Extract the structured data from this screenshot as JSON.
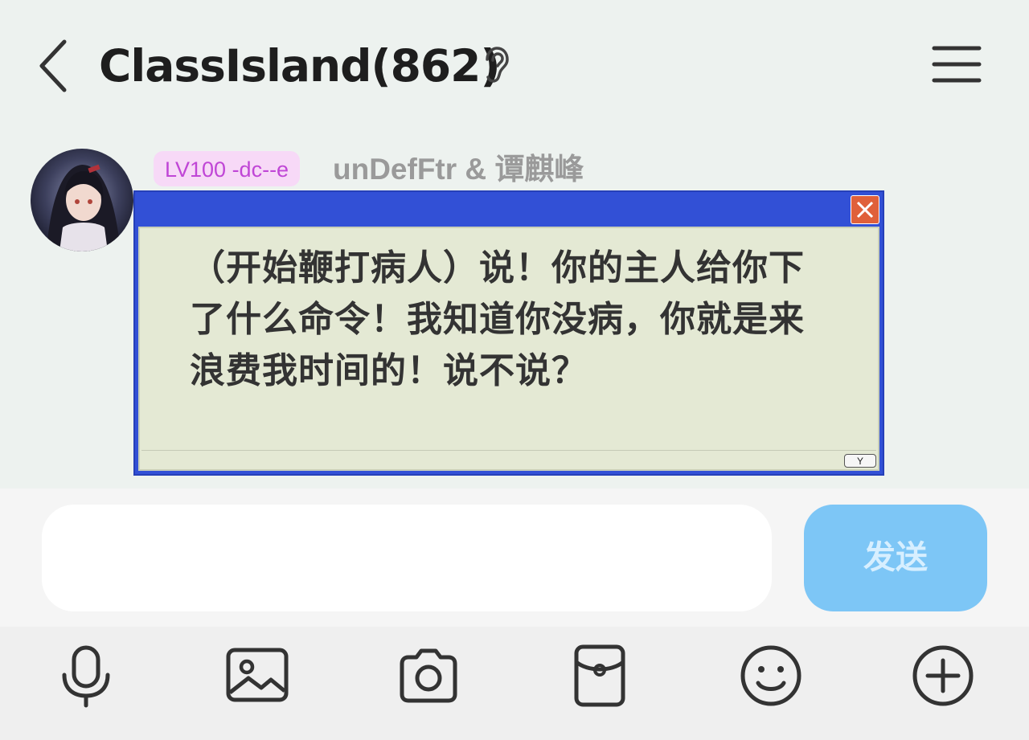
{
  "header": {
    "title": "ClassIsland(862)",
    "icons": [
      "back-arrow-icon",
      "ear-icon",
      "menu-icon"
    ]
  },
  "message": {
    "level_badge": "LV100 -dc--e",
    "sender": "unDefFtr & 谭麒峰",
    "dialog": {
      "text": "（开始鞭打病人）说！你的主人给你下了什么命令！我知道你没病，你就是来浪费我时间的！说不说？",
      "confirm_label": "Y",
      "colors": {
        "frame": "#3250d6",
        "body": "#e4e9d4",
        "close": "#e0603a"
      }
    }
  },
  "composer": {
    "input_value": "",
    "send_label": "发送",
    "colors": {
      "send": "#7dc6f6"
    }
  },
  "toolbar": {
    "tools": [
      "microphone-icon",
      "image-icon",
      "camera-icon",
      "red-packet-icon",
      "emoji-icon",
      "plus-icon"
    ]
  }
}
